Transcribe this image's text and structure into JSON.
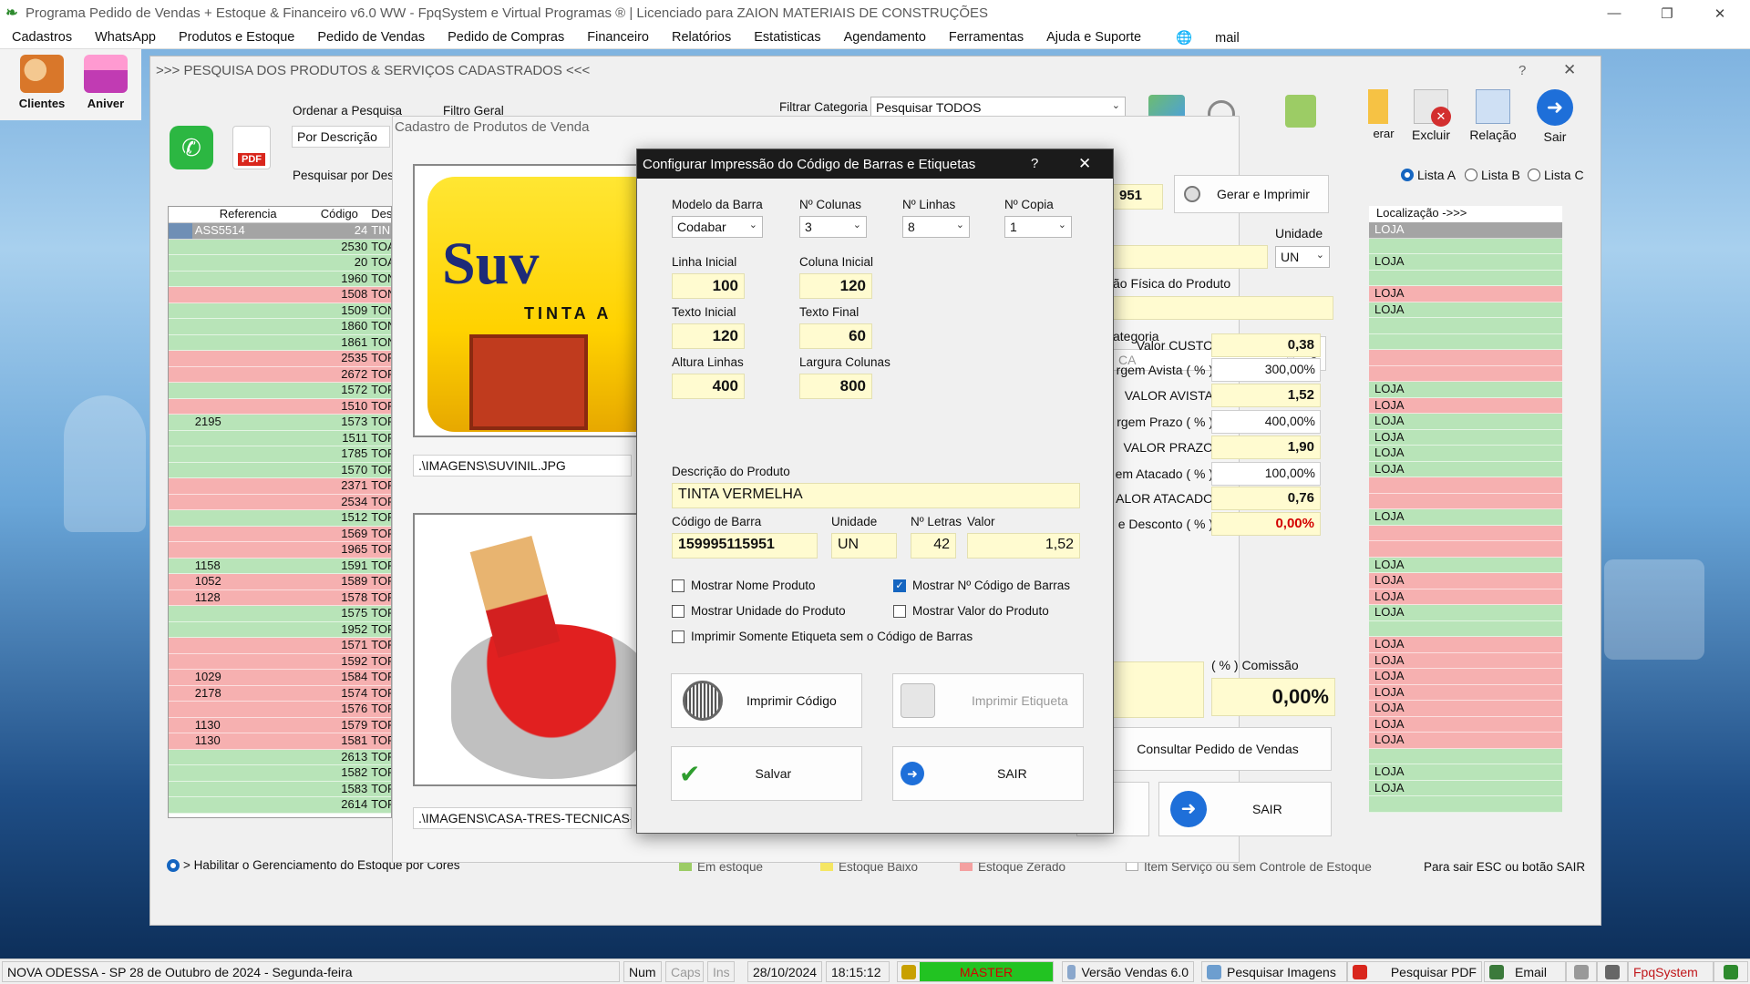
{
  "window": {
    "title": "Programa Pedido de Vendas + Estoque & Financeiro v6.0 WW - FpqSystem e Virtual Programas ® | Licenciado para  ZAION MATERIAIS DE CONSTRUÇÕES"
  },
  "menu": [
    "Cadastros",
    "WhatsApp",
    "Produtos e Estoque",
    "Pedido de Vendas",
    "Pedido de Compras",
    "Financeiro",
    "Relatórios",
    "Estatisticas",
    "Agendamento",
    "Ferramentas",
    "Ajuda e Suporte",
    "mail"
  ],
  "left_toolbar": {
    "clientes": "Clientes",
    "aniver": "Aniver"
  },
  "search_window": {
    "title": ">>>  PESQUISA DOS PRODUTOS & SERVIÇOS CADASTRADOS  <<<",
    "help": "?",
    "order_label": "Ordenar a Pesquisa",
    "order_value": "Por Descrição",
    "filter_general_label": "Filtro Geral",
    "filter_category_label": "Filtrar Categoria",
    "filter_category_value": "Pesquisar TODOS",
    "search_by_label": "Pesquisar por Des",
    "grid_headers": {
      "ref": "Referencia",
      "code": "Código",
      "desc": "Des"
    },
    "grid_rows": [
      {
        "ref": "ASS5514",
        "code": "24",
        "desc": "TIN",
        "color": "sel"
      },
      {
        "ref": "",
        "code": "2530",
        "desc": "TOA",
        "color": "green"
      },
      {
        "ref": "",
        "code": "20",
        "desc": "TOA",
        "color": "green"
      },
      {
        "ref": "",
        "code": "1960",
        "desc": "TON",
        "color": "green"
      },
      {
        "ref": "",
        "code": "1508",
        "desc": "TON",
        "color": "pink"
      },
      {
        "ref": "",
        "code": "1509",
        "desc": "TON",
        "color": "green"
      },
      {
        "ref": "",
        "code": "1860",
        "desc": "TON",
        "color": "green"
      },
      {
        "ref": "",
        "code": "1861",
        "desc": "TON",
        "color": "green"
      },
      {
        "ref": "",
        "code": "2535",
        "desc": "TOF",
        "color": "pink"
      },
      {
        "ref": "",
        "code": "2672",
        "desc": "TOF",
        "color": "pink"
      },
      {
        "ref": "",
        "code": "1572",
        "desc": "TOF",
        "color": "green"
      },
      {
        "ref": "",
        "code": "1510",
        "desc": "TOF",
        "color": "pink"
      },
      {
        "ref": "2195",
        "code": "1573",
        "desc": "TOF",
        "color": "green"
      },
      {
        "ref": "",
        "code": "1511",
        "desc": "TOF",
        "color": "green"
      },
      {
        "ref": "",
        "code": "1785",
        "desc": "TOF",
        "color": "green"
      },
      {
        "ref": "",
        "code": "1570",
        "desc": "TOF",
        "color": "green"
      },
      {
        "ref": "",
        "code": "2371",
        "desc": "TOF",
        "color": "pink"
      },
      {
        "ref": "",
        "code": "2534",
        "desc": "TOF",
        "color": "pink"
      },
      {
        "ref": "",
        "code": "1512",
        "desc": "TOF",
        "color": "green"
      },
      {
        "ref": "",
        "code": "1569",
        "desc": "TOF",
        "color": "pink"
      },
      {
        "ref": "",
        "code": "1965",
        "desc": "TOF",
        "color": "pink"
      },
      {
        "ref": "1158",
        "code": "1591",
        "desc": "TOF",
        "color": "green"
      },
      {
        "ref": "1052",
        "code": "1589",
        "desc": "TOF",
        "color": "pink"
      },
      {
        "ref": "1128",
        "code": "1578",
        "desc": "TOF",
        "color": "pink"
      },
      {
        "ref": "",
        "code": "1575",
        "desc": "TOF",
        "color": "green"
      },
      {
        "ref": "",
        "code": "1952",
        "desc": "TOF",
        "color": "green"
      },
      {
        "ref": "",
        "code": "1571",
        "desc": "TOF",
        "color": "pink"
      },
      {
        "ref": "",
        "code": "1592",
        "desc": "TOF",
        "color": "pink"
      },
      {
        "ref": "1029",
        "code": "1584",
        "desc": "TOF",
        "color": "pink"
      },
      {
        "ref": "2178",
        "code": "1574",
        "desc": "TOF",
        "color": "pink"
      },
      {
        "ref": "",
        "code": "1576",
        "desc": "TOF",
        "color": "pink"
      },
      {
        "ref": "1130",
        "code": "1579",
        "desc": "TOF",
        "color": "pink"
      },
      {
        "ref": "1130",
        "code": "1581",
        "desc": "TOF",
        "color": "pink"
      },
      {
        "ref": "",
        "code": "2613",
        "desc": "TOF",
        "color": "green"
      },
      {
        "ref": "",
        "code": "1582",
        "desc": "TOF",
        "color": "green"
      },
      {
        "ref": "",
        "code": "1583",
        "desc": "TOF",
        "color": "green"
      },
      {
        "ref": "",
        "code": "2614",
        "desc": "TOF",
        "color": "green"
      }
    ],
    "right_grid_header": "Localização ->>>",
    "right_grid_rows": [
      {
        "loc": "LOJA",
        "color": "sel"
      },
      {
        "loc": "",
        "color": "green"
      },
      {
        "loc": "LOJA",
        "color": "green"
      },
      {
        "loc": "",
        "color": "green"
      },
      {
        "loc": "LOJA",
        "color": "pink"
      },
      {
        "loc": "LOJA",
        "color": "green"
      },
      {
        "loc": "",
        "color": "green"
      },
      {
        "loc": "",
        "color": "green"
      },
      {
        "loc": "",
        "color": "pink"
      },
      {
        "loc": "",
        "color": "pink"
      },
      {
        "loc": "LOJA",
        "color": "green"
      },
      {
        "loc": "LOJA",
        "color": "pink"
      },
      {
        "loc": "LOJA",
        "color": "green"
      },
      {
        "loc": "LOJA",
        "color": "green"
      },
      {
        "loc": "LOJA",
        "color": "green"
      },
      {
        "loc": "LOJA",
        "color": "green"
      },
      {
        "loc": "",
        "color": "pink"
      },
      {
        "loc": "",
        "color": "pink"
      },
      {
        "loc": "LOJA",
        "color": "green"
      },
      {
        "loc": "",
        "color": "pink"
      },
      {
        "loc": "",
        "color": "pink"
      },
      {
        "loc": "LOJA",
        "color": "green"
      },
      {
        "loc": "LOJA",
        "color": "pink"
      },
      {
        "loc": "LOJA",
        "color": "pink"
      },
      {
        "loc": "LOJA",
        "color": "green"
      },
      {
        "loc": "",
        "color": "green"
      },
      {
        "loc": "LOJA",
        "color": "pink"
      },
      {
        "loc": "LOJA",
        "color": "pink"
      },
      {
        "loc": "LOJA",
        "color": "pink"
      },
      {
        "loc": "LOJA",
        "color": "pink"
      },
      {
        "loc": "LOJA",
        "color": "pink"
      },
      {
        "loc": "LOJA",
        "color": "pink"
      },
      {
        "loc": "LOJA",
        "color": "pink"
      },
      {
        "loc": "",
        "color": "green"
      },
      {
        "loc": "LOJA",
        "color": "green"
      },
      {
        "loc": "LOJA",
        "color": "green"
      },
      {
        "loc": "",
        "color": "green"
      }
    ],
    "toolbar": {
      "gerar": "erar",
      "excluir": "Excluir",
      "relacao": "Relação",
      "sair": "Sair"
    },
    "radios": {
      "lista_a": "Lista A",
      "lista_b": "Lista B",
      "lista_c": "Lista C"
    },
    "bottom_left": "> Habilitar o Gerenciamento do Estoque por Cores",
    "legend": {
      "em_estoque": "Em estoque",
      "estoque_baixo": "Estoque Baixo",
      "estoque_zerado": "Estoque Zerado",
      "servico": "Item Serviço ou sem Controle de Estoque"
    },
    "hint": "Para sair ESC ou botão SAIR"
  },
  "product_window": {
    "title": "Cadastro de Produtos de Venda",
    "image1_path": ".\\IMAGENS\\SUVINIL.JPG",
    "image2_path": ".\\IMAGENS\\CASA-TRES-TECNICAS-P",
    "image1_brand": "Suv",
    "image1_sub": "TINTA A",
    "gerar_imprimir": "Gerar e Imprimir",
    "code_partial": "951",
    "unidade_label": "Unidade",
    "unidade_value": "UN",
    "localizacao_label": "ão Física do Produto",
    "categoria_label": "ategoria",
    "categoria_value": "CA",
    "prices": [
      {
        "label": "Valor CUSTO",
        "value": "0,38"
      },
      {
        "label": "rgem Avista ( % )",
        "value": "300,00%"
      },
      {
        "label": "VALOR AVISTA",
        "value": "1,52"
      },
      {
        "label": "rgem Prazo ( % )",
        "value": "400,00%"
      },
      {
        "label": "VALOR PRAZO",
        "value": "1,90"
      },
      {
        "label": "em Atacado ( % )",
        "value": "100,00%"
      },
      {
        "label": "ALOR ATACADO",
        "value": "0,76"
      },
      {
        "label": "e Desconto ( % )",
        "value": "0,00%"
      }
    ],
    "comissao_label": "( % ) Comissão",
    "comissao_value": "0,00%",
    "consultar": "Consultar Pedido de Vendas",
    "sair": "SAIR"
  },
  "dialog": {
    "title": "Configurar Impressão do Código de Barras e Etiquetas",
    "help": "?",
    "modelo_label": "Modelo da Barra",
    "modelo_value": "Codabar",
    "colunas_label": "Nº Colunas",
    "colunas_value": "3",
    "linhas_label": "Nº Linhas",
    "linhas_value": "8",
    "copia_label": "Nº Copia",
    "copia_value": "1",
    "linha_inicial_label": "Linha Inicial",
    "linha_inicial_value": "100",
    "coluna_inicial_label": "Coluna Inicial",
    "coluna_inicial_value": "120",
    "texto_inicial_label": "Texto Inicial",
    "texto_inicial_value": "120",
    "texto_final_label": "Texto Final",
    "texto_final_value": "60",
    "altura_label": "Altura Linhas",
    "altura_value": "400",
    "largura_label": "Largura Colunas",
    "largura_value": "800",
    "descricao_label": "Descrição do Produto",
    "descricao_value": "TINTA VERMELHA",
    "codigo_label": "Código de Barra",
    "codigo_value": "159995115951",
    "unidade_label": "Unidade",
    "unidade_value": "UN",
    "letras_label": "Nº Letras",
    "letras_value": "42",
    "valor_label": "Valor",
    "valor_value": "1,52",
    "chk_nome": "Mostrar Nome Produto",
    "chk_codigo": "Mostrar Nº Código de Barras",
    "chk_unidade": "Mostrar Unidade do Produto",
    "chk_valor": "Mostrar Valor do Produto",
    "chk_somente": "Imprimir Somente Etiqueta sem o Código de Barras",
    "btn_imprimir_codigo": "Imprimir Código",
    "btn_imprimir_etiqueta": "Imprimir Etiqueta",
    "btn_salvar": "Salvar",
    "btn_sair": "SAIR"
  },
  "statusbar": {
    "location": "NOVA ODESSA - SP 28 de Outubro de 2024 - Segunda-feira",
    "num": "Num",
    "caps": "Caps",
    "ins": "Ins",
    "date": "28/10/2024",
    "time": "18:15:12",
    "user": "MASTER",
    "versao": "Versão Vendas 6.0",
    "pesq_imagens": "Pesquisar Imagens",
    "pesq_pdf": "Pesquisar PDF",
    "email": "Email",
    "brand": "FpqSystem"
  },
  "colors": {
    "accent": "#1565c0",
    "yellow_field": "#fffbd0",
    "row_green": "#b8e4b8",
    "row_pink": "#f6b0b0",
    "status_green": "#22c322",
    "brand_red": "#c0161a"
  }
}
